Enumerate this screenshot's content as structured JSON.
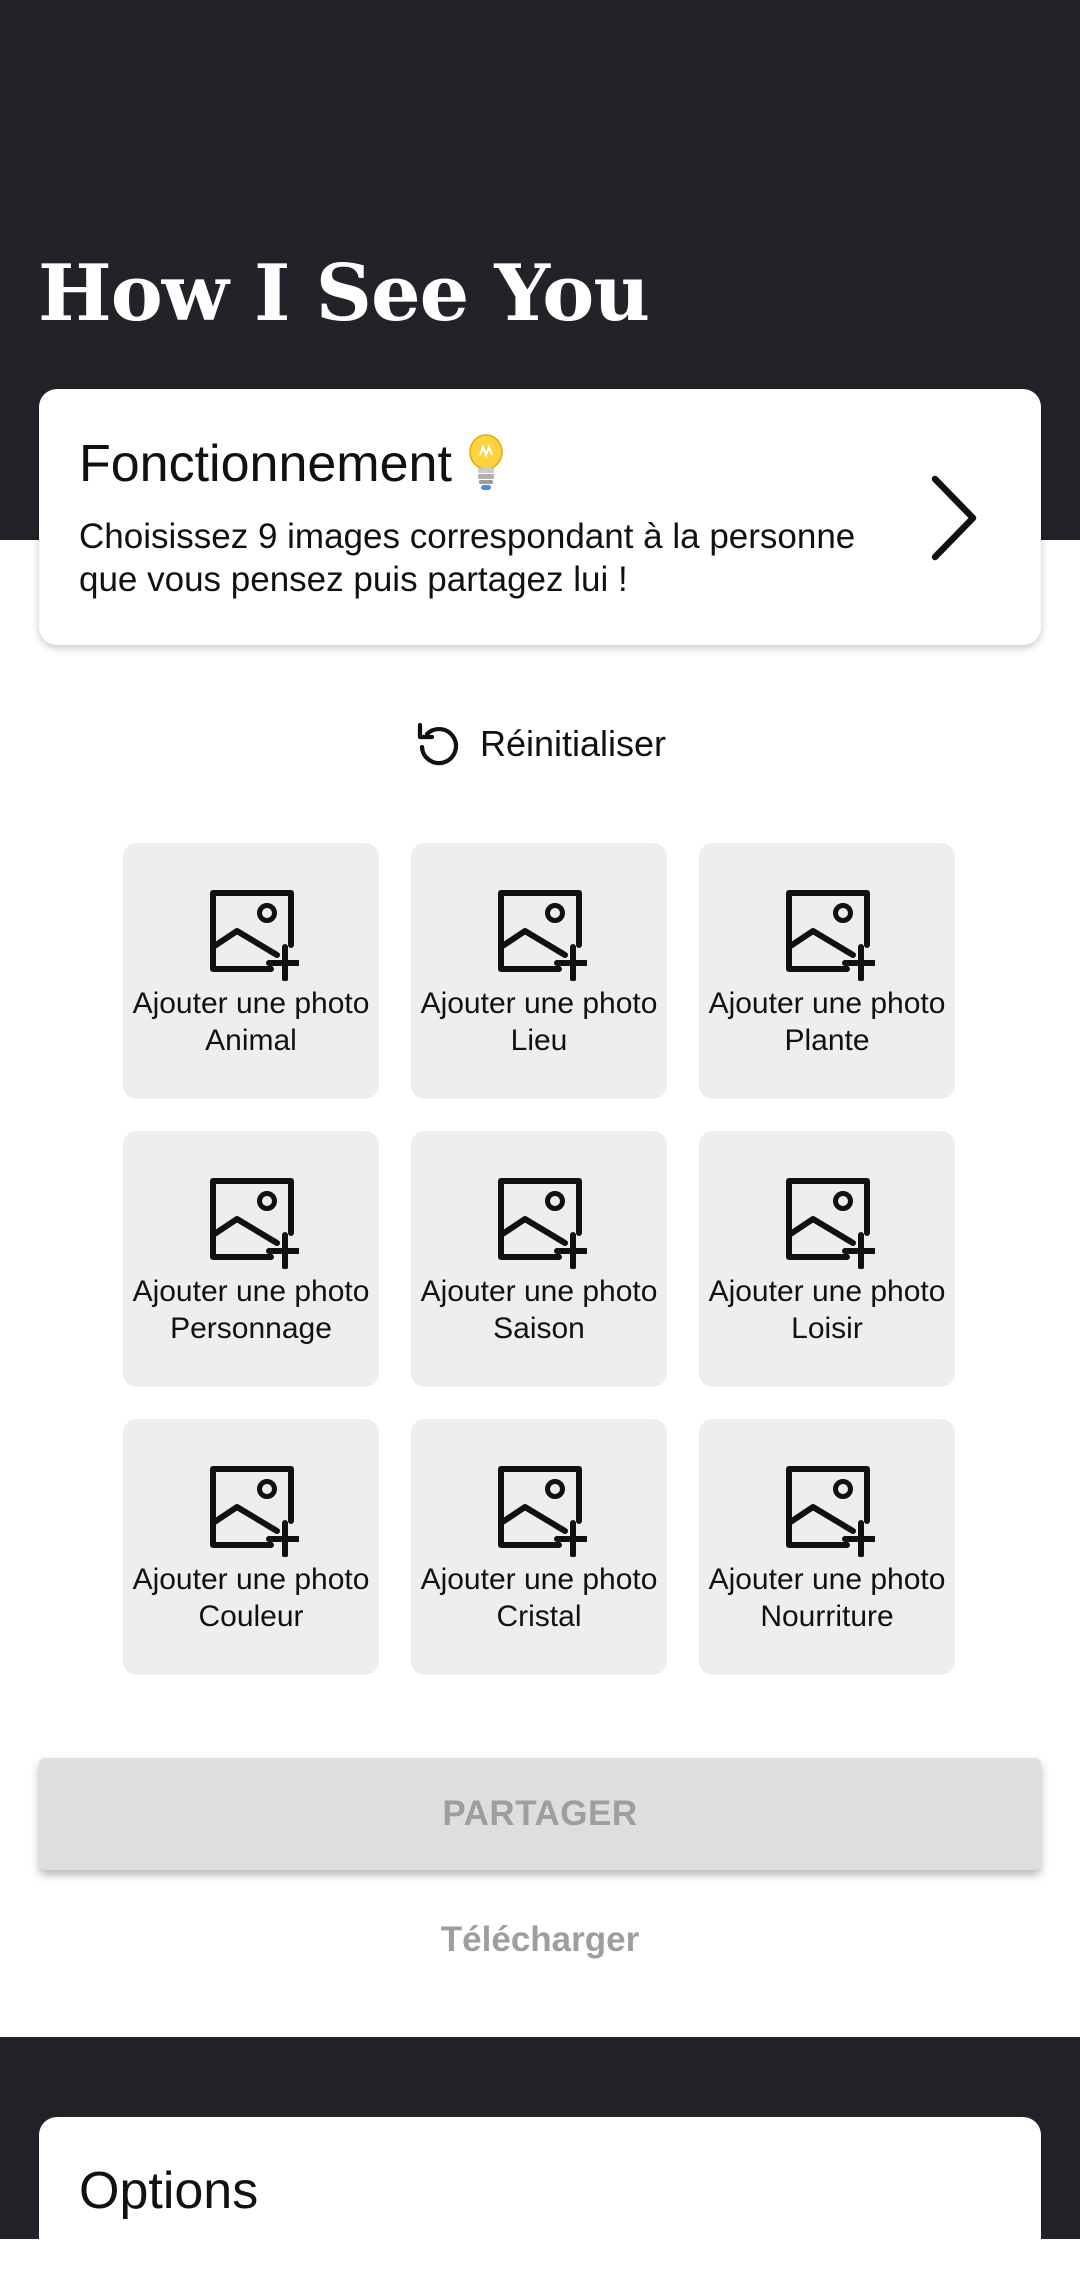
{
  "app": {
    "title": "How I See You"
  },
  "info_card": {
    "title": "Fonctionnement",
    "icon": "lightbulb-icon",
    "text": "Choisissez 9 images correspondant à la personne que vous pensez puis partagez lui !",
    "chevron_icon": "chevron-right-icon"
  },
  "reset": {
    "label": "Réinitialiser",
    "icon": "reset-icon"
  },
  "grid": {
    "tile_action": "Ajouter une photo",
    "tile_icon": "add-photo-icon",
    "tiles": [
      {
        "category": "Animal"
      },
      {
        "category": "Lieu"
      },
      {
        "category": "Plante"
      },
      {
        "category": "Personnage"
      },
      {
        "category": "Saison"
      },
      {
        "category": "Loisir"
      },
      {
        "category": "Couleur"
      },
      {
        "category": "Cristal"
      },
      {
        "category": "Nourriture"
      }
    ]
  },
  "actions": {
    "share_label": "PARTAGER",
    "download_label": "Télécharger"
  },
  "options": {
    "title": "Options"
  },
  "colors": {
    "dark_band": "#222329",
    "tile_background": "#eeeeee",
    "disabled_button": "#dedede",
    "disabled_text": "#9e9e9e"
  }
}
